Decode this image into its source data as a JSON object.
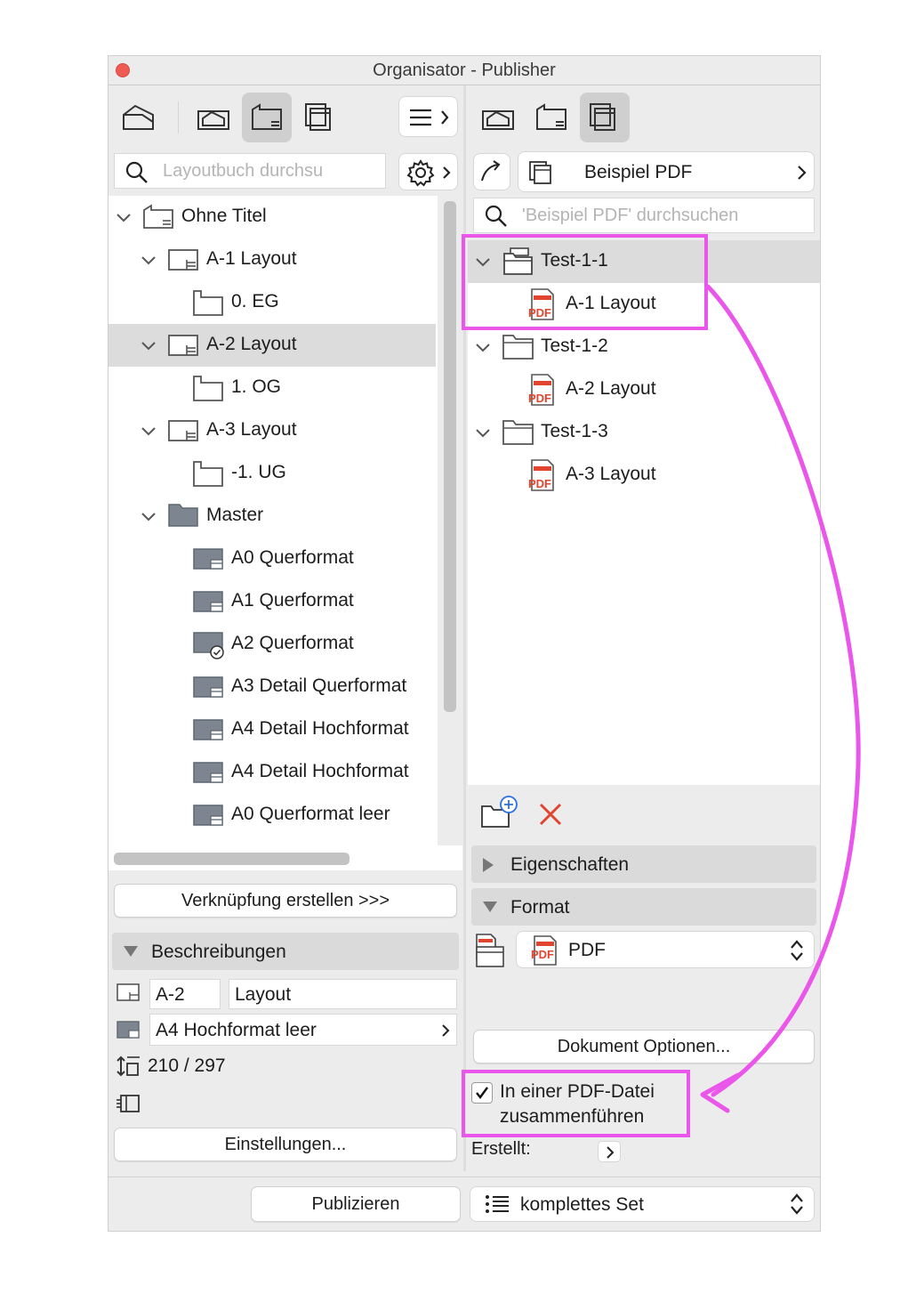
{
  "window": {
    "title": "Organisator - Publisher"
  },
  "left": {
    "search_placeholder": "Layoutbuch durchsu",
    "tree": [
      {
        "label": "Ohne Titel"
      },
      {
        "label": "A-1 Layout"
      },
      {
        "label": "0. EG"
      },
      {
        "label": "A-2 Layout"
      },
      {
        "label": "1. OG"
      },
      {
        "label": "A-3 Layout"
      },
      {
        "label": "-1. UG"
      },
      {
        "label": "Master"
      },
      {
        "label": "A0 Querformat"
      },
      {
        "label": "A1 Querformat"
      },
      {
        "label": "A2 Querformat"
      },
      {
        "label": "A3 Detail Querformat"
      },
      {
        "label": "A4 Detail Hochformat"
      },
      {
        "label": "A4 Detail Hochformat"
      },
      {
        "label": "A0 Querformat leer"
      }
    ],
    "link_button": "Verknüpfung erstellen >>>",
    "descriptions_header": "Beschreibungen",
    "id_value": "A-2",
    "name_value": "Layout",
    "master_value": "A4 Hochformat leer",
    "size_value": "210 / 297",
    "settings_button": "Einstellungen..."
  },
  "right": {
    "set_name": "Beispiel PDF",
    "search_placeholder": "'Beispiel PDF' durchsuchen",
    "tree": [
      {
        "label": "Test-1-1"
      },
      {
        "label": "A-1 Layout"
      },
      {
        "label": "Test-1-2"
      },
      {
        "label": "A-2 Layout"
      },
      {
        "label": "Test-1-3"
      },
      {
        "label": "A-3 Layout"
      }
    ],
    "properties_header": "Eigenschaften",
    "format_header": "Format",
    "format_value": "PDF",
    "pdf_badge": "PDF",
    "doc_options_button": "Dokument Optionen...",
    "merge_checkbox_line1": "In einer PDF-Datei",
    "merge_checkbox_line2": "zusammenführen",
    "merge_checked": true,
    "created_label": "Erstellt:"
  },
  "footer": {
    "publish_button": "Publizieren",
    "set_select": "komplettes Set"
  },
  "colors": {
    "annotation": "#ea55ea",
    "pdf_red": "#e2452f",
    "selection": "#dcdcdc"
  }
}
